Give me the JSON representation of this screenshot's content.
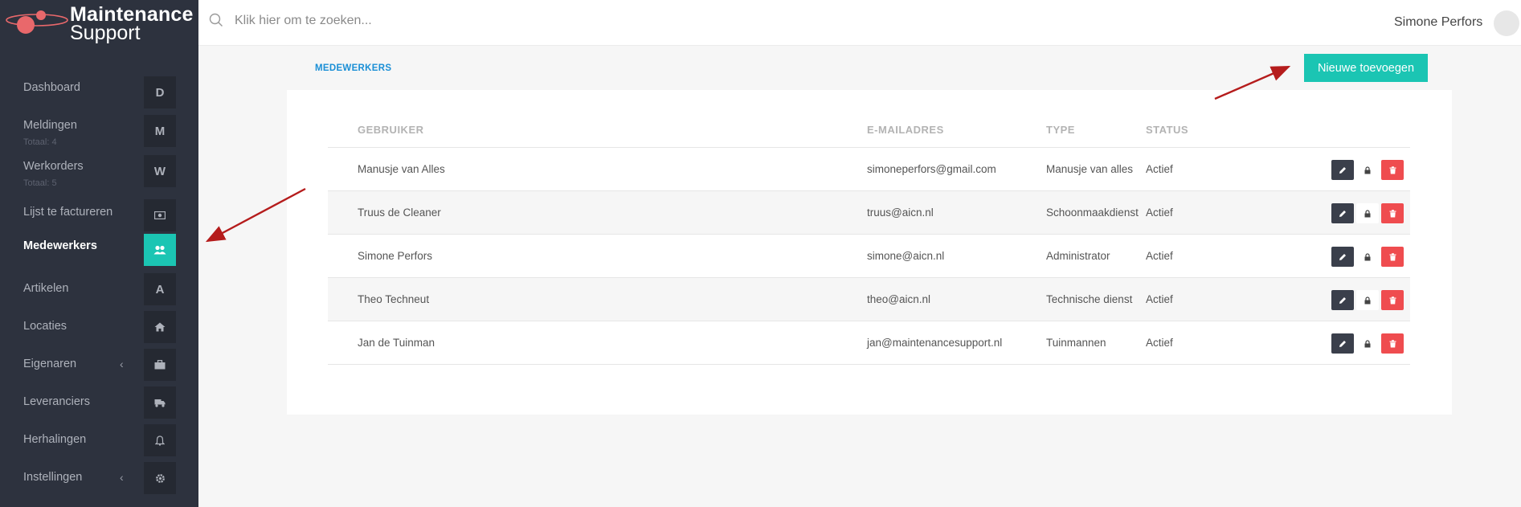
{
  "app": {
    "logo_title": "Maintenance",
    "logo_subtitle": "Support"
  },
  "search": {
    "placeholder": "Klik hier om te zoeken..."
  },
  "user": {
    "name": "Simone Perfors"
  },
  "sidebar": {
    "items": [
      {
        "label": "Dashboard",
        "box": "D"
      },
      {
        "label": "Meldingen",
        "sub": "Totaal: 4",
        "box": "M"
      },
      {
        "label": "Werkorders",
        "sub": "Totaal: 5",
        "box": "W"
      },
      {
        "label": "Lijst te factureren",
        "icon": "money-icon"
      },
      {
        "label": "Medewerkers",
        "icon": "users-icon",
        "active": true
      },
      {
        "label": "Artikelen",
        "box": "A"
      },
      {
        "label": "Locaties",
        "icon": "home-icon"
      },
      {
        "label": "Eigenaren",
        "icon": "briefcase-icon",
        "chevron": "‹"
      },
      {
        "label": "Leveranciers",
        "icon": "truck-icon"
      },
      {
        "label": "Herhalingen",
        "icon": "bell-icon"
      },
      {
        "label": "Instellingen",
        "icon": "gear-icon",
        "chevron": "‹"
      }
    ]
  },
  "page": {
    "breadcrumb": "MEDEWERKERS",
    "add_button_label": "Nieuwe toevoegen"
  },
  "table": {
    "headers": [
      "GEBRUIKER",
      "E-MAILADRES",
      "TYPE",
      "STATUS"
    ],
    "rows": [
      {
        "user": "Manusje van Alles",
        "email": "simoneperfors@gmail.com",
        "type": "Manusje van alles",
        "status": "Actief"
      },
      {
        "user": "Truus de Cleaner",
        "email": "truus@aicn.nl",
        "type": "Schoonmaakdienst",
        "status": "Actief"
      },
      {
        "user": "Simone Perfors",
        "email": "simone@aicn.nl",
        "type": "Administrator",
        "status": "Actief"
      },
      {
        "user": "Theo Techneut",
        "email": "theo@aicn.nl",
        "type": "Technische dienst",
        "status": "Actief"
      },
      {
        "user": "Jan de Tuinman",
        "email": "jan@maintenancesupport.nl",
        "type": "Tuinmannen",
        "status": "Actief"
      }
    ]
  },
  "colors": {
    "accent": "#1bc5b3",
    "sidebar_bg": "#2d323e",
    "delete": "#ef4c4f",
    "annotation_arrow": "#b51c1c"
  }
}
